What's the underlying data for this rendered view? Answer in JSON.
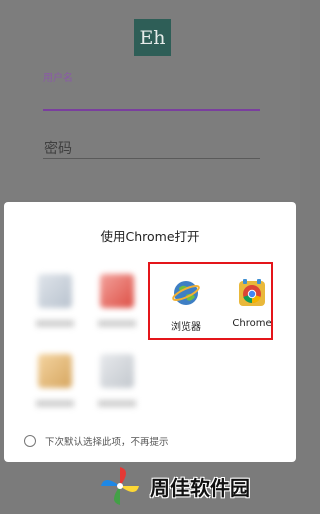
{
  "login": {
    "logo_text": "Eh",
    "username_label": "用户名",
    "password_placeholder": "密码"
  },
  "chooser": {
    "title": "使用Chrome打开",
    "apps": [
      {
        "label": "浏览器",
        "icon": "globe-icon"
      },
      {
        "label": "Chrome",
        "icon": "chrome-icon"
      }
    ],
    "remember_label": "下次默认选择此项，不再提示"
  },
  "watermark": {
    "text": "周佳软件园"
  },
  "colors": {
    "highlight": "#e4151a",
    "accent": "#7a3f9e"
  }
}
